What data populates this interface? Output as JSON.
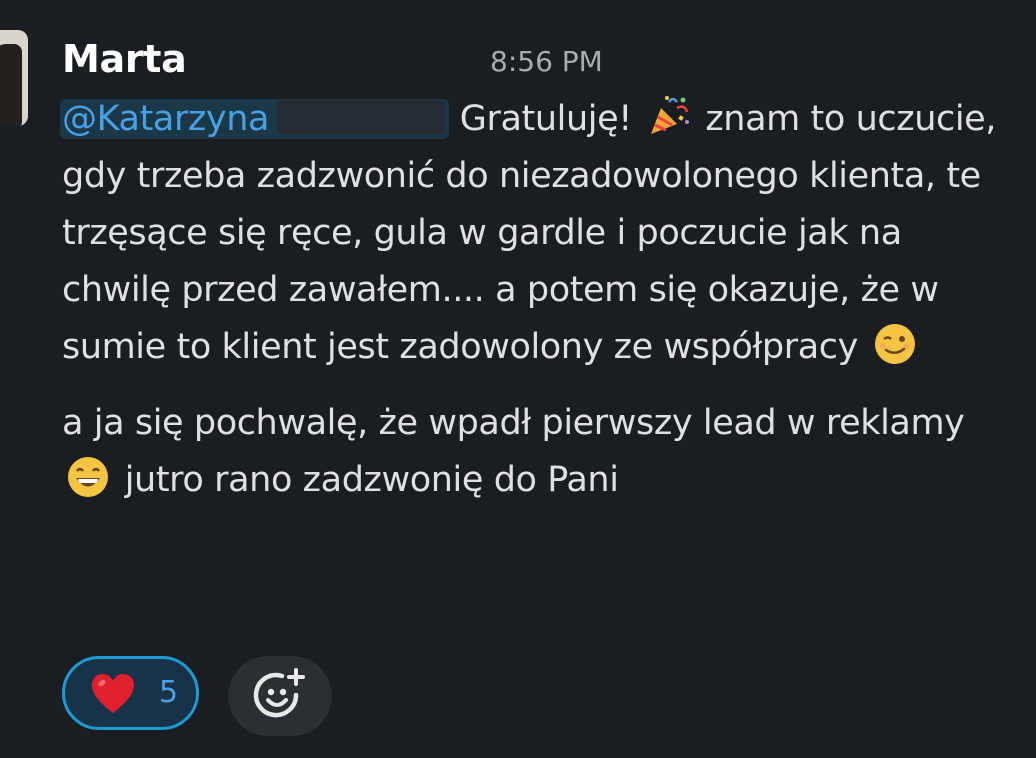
{
  "message": {
    "sender": "Marta",
    "timestamp": "8:56 PM",
    "mention": "@Katarzyna",
    "paragraph1": {
      "after_mention": " Gratuluję!",
      "emoji1": "party-popper-icon",
      "text2": " znam to uczucie, gdy trzeba zadzwonić do niezadowolonego klienta, te trzęsące się ręce, gula w gardle i poczucie jak na chwilę przed zawałem.... a potem się okazuje, że w sumie to klient jest zadowolony ze współpracy",
      "emoji2": "winking-face-icon"
    },
    "paragraph2": {
      "text1": "a ja się pochwalę, że wpadł pierwszy lead w reklamy",
      "emoji": "grinning-face-icon",
      "text2": " jutro rano zadzwonię do Pani"
    }
  },
  "reactions": [
    {
      "emoji": "red-heart-icon",
      "count": "5",
      "active": true
    }
  ],
  "add_reaction": {
    "icon": "add-reaction-icon"
  },
  "colors": {
    "background": "#1a1d21",
    "mention_text": "#4aa0e5",
    "mention_bg": "#1d9bd1",
    "reaction_border": "#1d9bd1",
    "text": "#e0e0e1",
    "timestamp": "#ababad"
  }
}
